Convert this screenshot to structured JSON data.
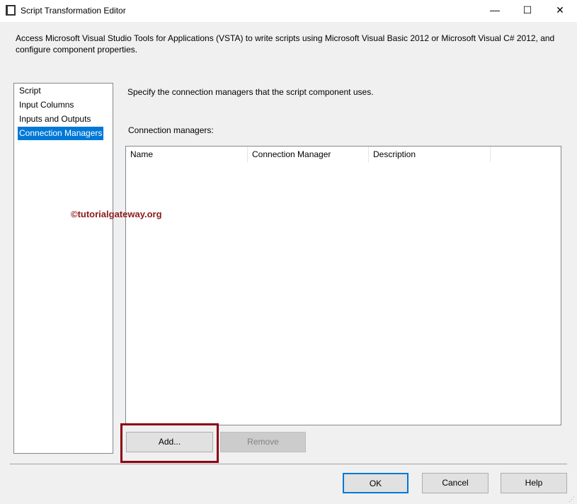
{
  "window": {
    "title": "Script Transformation Editor",
    "minimize": "—",
    "maximize": "☐",
    "close": "✕"
  },
  "description": "Access Microsoft Visual Studio Tools for Applications (VSTA) to write scripts using Microsoft Visual Basic 2012 or Microsoft Visual C# 2012, and configure component properties.",
  "nav": {
    "items": [
      {
        "label": "Script"
      },
      {
        "label": "Input Columns"
      },
      {
        "label": "Inputs and Outputs"
      },
      {
        "label": "Connection Managers"
      }
    ],
    "selected": "Connection Managers"
  },
  "main": {
    "instruction": "Specify the connection managers that the script component uses.",
    "list_label": "Connection managers:",
    "columns": [
      "Name",
      "Connection Manager",
      "Description"
    ],
    "add": "Add...",
    "remove": "Remove"
  },
  "watermark": "©tutorialgateway.org",
  "footer": {
    "ok": "OK",
    "cancel": "Cancel",
    "help": "Help"
  }
}
